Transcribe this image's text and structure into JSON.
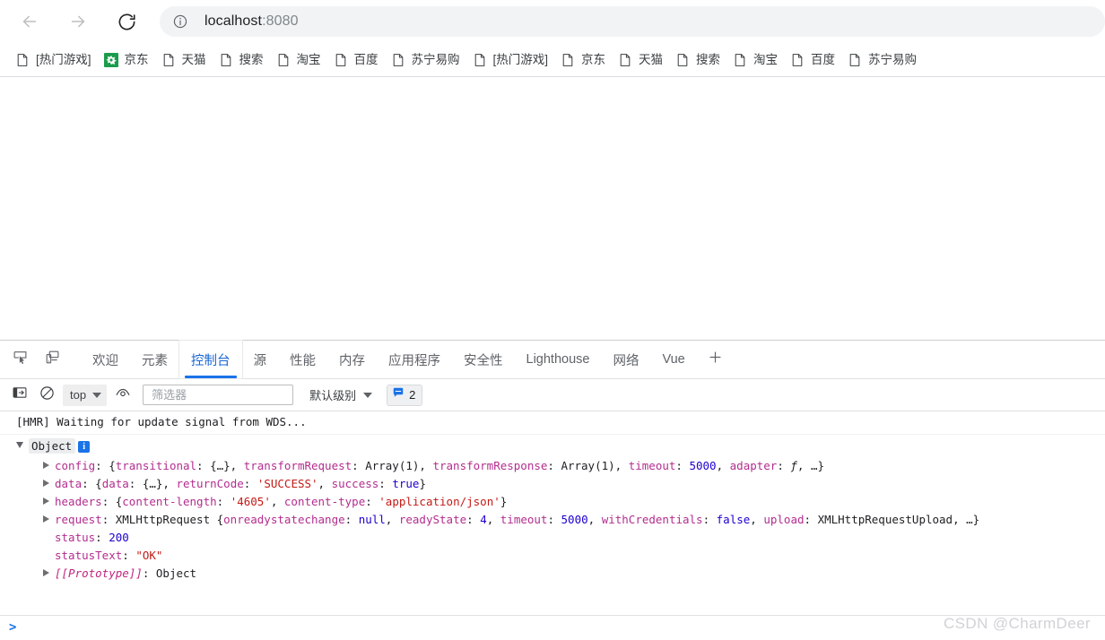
{
  "browser": {
    "back_label": "Back",
    "forward_label": "Forward",
    "reload_label": "Reload",
    "site_info_label": "View site information",
    "url_host": "localhost",
    "url_port": ":8080",
    "bookmarks": [
      {
        "label": "[热门游戏]",
        "icon": "page-icon"
      },
      {
        "label": "京东",
        "icon": "jd-favicon"
      },
      {
        "label": "天猫",
        "icon": "page-icon"
      },
      {
        "label": "搜索",
        "icon": "page-icon"
      },
      {
        "label": "淘宝",
        "icon": "page-icon"
      },
      {
        "label": "百度",
        "icon": "page-icon"
      },
      {
        "label": "苏宁易购",
        "icon": "page-icon"
      },
      {
        "label": "[热门游戏]",
        "icon": "page-icon"
      },
      {
        "label": "京东",
        "icon": "page-icon"
      },
      {
        "label": "天猫",
        "icon": "page-icon"
      },
      {
        "label": "搜索",
        "icon": "page-icon"
      },
      {
        "label": "淘宝",
        "icon": "page-icon"
      },
      {
        "label": "百度",
        "icon": "page-icon"
      },
      {
        "label": "苏宁易购",
        "icon": "page-icon"
      }
    ]
  },
  "devtools": {
    "inspect_icon_label": "检查元素",
    "device_icon_label": "切换设备工具栏",
    "tabs": [
      {
        "label": "欢迎",
        "active": false
      },
      {
        "label": "元素",
        "active": false
      },
      {
        "label": "控制台",
        "active": true
      },
      {
        "label": "源",
        "active": false
      },
      {
        "label": "性能",
        "active": false
      },
      {
        "label": "内存",
        "active": false
      },
      {
        "label": "应用程序",
        "active": false
      },
      {
        "label": "安全性",
        "active": false
      },
      {
        "label": "Lighthouse",
        "active": false
      },
      {
        "label": "网络",
        "active": false
      },
      {
        "label": "Vue",
        "active": false
      }
    ],
    "add_tab_label": "+",
    "console_toolbar": {
      "sidebar_toggle_label": "显示控制台边栏",
      "clear_label": "清除控制台",
      "context_value": "top",
      "eye_label": "创建实时表达式",
      "filter_placeholder": "筛选器",
      "filter_value": "",
      "level_label": "默认级别",
      "issues_count": "2",
      "issues_icon": "message-bubble-icon"
    },
    "console": {
      "hmr_message": "[HMR] Waiting for update signal from WDS...",
      "object_label": "Object",
      "rows": [
        {
          "expandable": true,
          "key": "config",
          "parts": [
            {
              "t": "plain",
              "v": ": {"
            },
            {
              "t": "k",
              "v": "transitional"
            },
            {
              "t": "plain",
              "v": ": {…}, "
            },
            {
              "t": "k",
              "v": "transformRequest"
            },
            {
              "t": "plain",
              "v": ": Array(1), "
            },
            {
              "t": "k",
              "v": "transformResponse"
            },
            {
              "t": "plain",
              "v": ": Array(1), "
            },
            {
              "t": "k",
              "v": "timeout"
            },
            {
              "t": "plain",
              "v": ": "
            },
            {
              "t": "num",
              "v": "5000"
            },
            {
              "t": "plain",
              "v": ", "
            },
            {
              "t": "k",
              "v": "adapter"
            },
            {
              "t": "plain",
              "v": ": "
            },
            {
              "t": "fn",
              "v": "ƒ"
            },
            {
              "t": "plain",
              "v": ", …}"
            }
          ]
        },
        {
          "expandable": true,
          "key": "data",
          "parts": [
            {
              "t": "plain",
              "v": ": {"
            },
            {
              "t": "k",
              "v": "data"
            },
            {
              "t": "plain",
              "v": ": {…}, "
            },
            {
              "t": "k",
              "v": "returnCode"
            },
            {
              "t": "plain",
              "v": ": "
            },
            {
              "t": "str",
              "v": "'SUCCESS'"
            },
            {
              "t": "plain",
              "v": ", "
            },
            {
              "t": "k",
              "v": "success"
            },
            {
              "t": "plain",
              "v": ": "
            },
            {
              "t": "bool",
              "v": "true"
            },
            {
              "t": "plain",
              "v": "}"
            }
          ]
        },
        {
          "expandable": true,
          "key": "headers",
          "parts": [
            {
              "t": "plain",
              "v": ": {"
            },
            {
              "t": "k",
              "v": "content-length"
            },
            {
              "t": "plain",
              "v": ": "
            },
            {
              "t": "str",
              "v": "'4605'"
            },
            {
              "t": "plain",
              "v": ", "
            },
            {
              "t": "k",
              "v": "content-type"
            },
            {
              "t": "plain",
              "v": ": "
            },
            {
              "t": "str",
              "v": "'application/json'"
            },
            {
              "t": "plain",
              "v": "}"
            }
          ]
        },
        {
          "expandable": true,
          "key": "request",
          "parts": [
            {
              "t": "plain",
              "v": ": XMLHttpRequest {"
            },
            {
              "t": "k",
              "v": "onreadystatechange"
            },
            {
              "t": "plain",
              "v": ": "
            },
            {
              "t": "bool",
              "v": "null"
            },
            {
              "t": "plain",
              "v": ", "
            },
            {
              "t": "k",
              "v": "readyState"
            },
            {
              "t": "plain",
              "v": ": "
            },
            {
              "t": "num",
              "v": "4"
            },
            {
              "t": "plain",
              "v": ", "
            },
            {
              "t": "k",
              "v": "timeout"
            },
            {
              "t": "plain",
              "v": ": "
            },
            {
              "t": "num",
              "v": "5000"
            },
            {
              "t": "plain",
              "v": ", "
            },
            {
              "t": "k",
              "v": "withCredentials"
            },
            {
              "t": "plain",
              "v": ": "
            },
            {
              "t": "bool",
              "v": "false"
            },
            {
              "t": "plain",
              "v": ", "
            },
            {
              "t": "k",
              "v": "upload"
            },
            {
              "t": "plain",
              "v": ": XMLHttpRequestUpload, …}"
            }
          ]
        },
        {
          "expandable": false,
          "key": "status",
          "parts": [
            {
              "t": "plain",
              "v": ": "
            },
            {
              "t": "num",
              "v": "200"
            }
          ]
        },
        {
          "expandable": false,
          "key": "statusText",
          "parts": [
            {
              "t": "plain",
              "v": ": "
            },
            {
              "t": "str",
              "v": "\"OK\""
            }
          ]
        },
        {
          "expandable": true,
          "key_italic": "[[Prototype]]",
          "parts": [
            {
              "t": "plain",
              "v": ": Object"
            }
          ]
        }
      ]
    }
  },
  "watermark": "CSDN @CharmDeer"
}
